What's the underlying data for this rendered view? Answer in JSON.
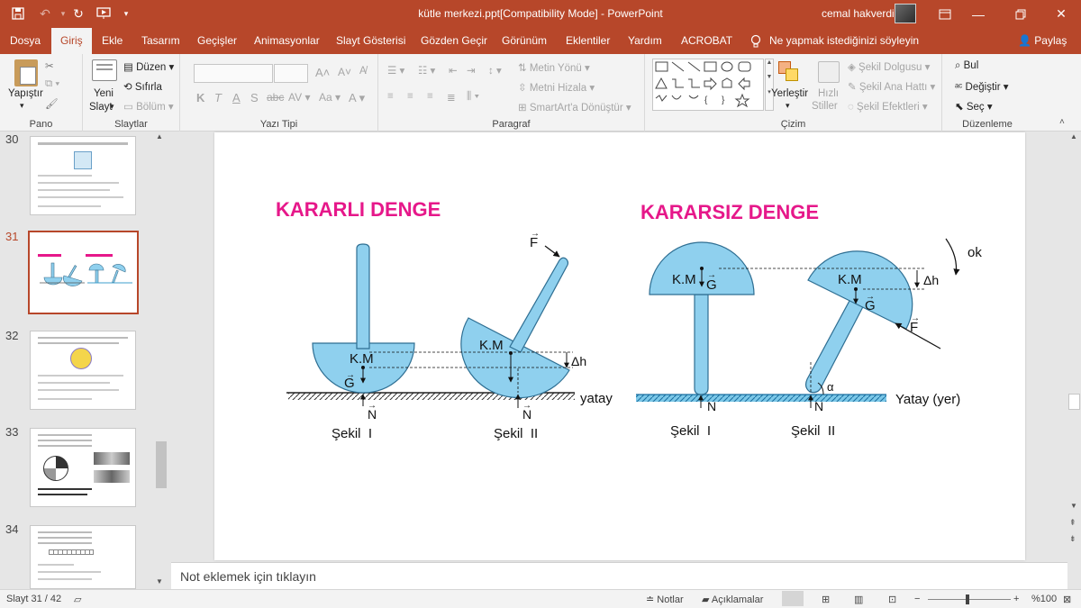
{
  "app": {
    "window_title": "kütle merkezi.ppt[Compatibility Mode]  -  PowerPoint",
    "user_name": "cemal hakverdi",
    "tabs": [
      "Dosya",
      "Giriş",
      "Ekle",
      "Tasarım",
      "Geçişler",
      "Animasyonlar",
      "Slayt Gösterisi",
      "Gözden Geçir",
      "Görünüm",
      "Eklentiler",
      "Yardım",
      "ACROBAT"
    ],
    "active_tab": "Giriş",
    "tell_me": "Ne yapmak istediğinizi söyleyin",
    "share": "Paylaş"
  },
  "ribbon": {
    "clipboard": {
      "label": "Pano",
      "paste": "Yapıştır"
    },
    "slides": {
      "label": "Slaytlar",
      "new_slide_1": "Yeni",
      "new_slide_2": "Slayt",
      "layout": "Düzen",
      "reset": "Sıfırla",
      "section": "Bölüm"
    },
    "font": {
      "label": "Yazı Tipi"
    },
    "paragraph": {
      "label": "Paragraf",
      "text_direction": "Metin Yönü",
      "align_text": "Metni Hizala",
      "smartart": "SmartArt'a Dönüştür"
    },
    "drawing": {
      "label": "Çizim",
      "arrange": "Yerleştir",
      "quick_styles_1": "Hızlı",
      "quick_styles_2": "Stiller",
      "shape_fill": "Şekil Dolgusu",
      "shape_outline": "Şekil Ana Hattı",
      "shape_effects": "Şekil Efektleri"
    },
    "editing": {
      "label": "Düzenleme",
      "find": "Bul",
      "replace": "Değiştir",
      "select": "Seç"
    }
  },
  "thumbnails": {
    "numbers": [
      "30",
      "31",
      "32",
      "33",
      "34"
    ],
    "selected": "31"
  },
  "slide": {
    "left_title": "KARARLI DENGE",
    "right_title": "KARARSIZ DENGE",
    "km": "K.M",
    "g": "G",
    "n": "N",
    "f": "F",
    "dh": "Δh",
    "alpha": "α",
    "ok": "ok",
    "yatay": "yatay",
    "yatay_yer": "Yatay (yer)",
    "sekil1": "Şekil  I",
    "sekil2": "Şekil  II",
    "title_color": "#e6188a",
    "shape_fill": "#8fd0ee"
  },
  "notes": {
    "placeholder": "Not eklemek için tıklayın"
  },
  "status": {
    "slide_info": "Slayt 31 / 42",
    "notes": "Notlar",
    "comments": "Açıklamalar",
    "zoom": "%100"
  }
}
